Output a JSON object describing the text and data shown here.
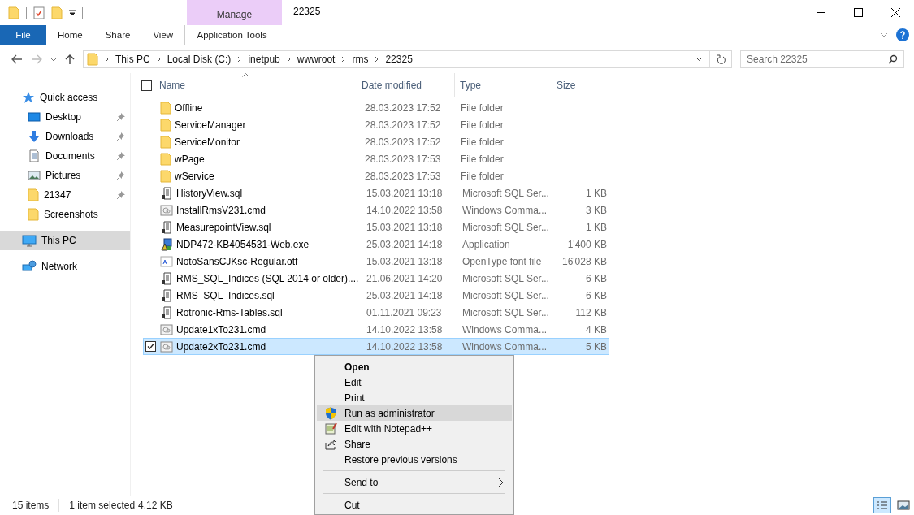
{
  "window": {
    "title": "22325",
    "context_tab": "Manage"
  },
  "ribbon_tabs": [
    {
      "label": "File",
      "kind": "file",
      "selected": false
    },
    {
      "label": "Home",
      "kind": "tab",
      "selected": false
    },
    {
      "label": "Share",
      "kind": "tab",
      "selected": false
    },
    {
      "label": "View",
      "kind": "tab",
      "selected": false
    },
    {
      "label": "Application Tools",
      "kind": "context",
      "selected": false
    }
  ],
  "address": {
    "path": [
      "This PC",
      "Local Disk (C:)",
      "inetpub",
      "wwwroot",
      "rms",
      "22325"
    ],
    "search_placeholder": "Search 22325"
  },
  "sidebar": {
    "items": [
      {
        "label": "Quick access",
        "kind": "star",
        "pinned": false,
        "selected": false,
        "group": true
      },
      {
        "label": "Desktop",
        "kind": "desktop",
        "pinned": true,
        "selected": false,
        "group": false
      },
      {
        "label": "Downloads",
        "kind": "downloads",
        "pinned": true,
        "selected": false,
        "group": false
      },
      {
        "label": "Documents",
        "kind": "documents",
        "pinned": true,
        "selected": false,
        "group": false
      },
      {
        "label": "Pictures",
        "kind": "pictures",
        "pinned": true,
        "selected": false,
        "group": false
      },
      {
        "label": "21347",
        "kind": "folder",
        "pinned": true,
        "selected": false,
        "group": false
      },
      {
        "label": "Screenshots",
        "kind": "folder",
        "pinned": false,
        "selected": false,
        "group": false
      },
      {
        "label": "This PC",
        "kind": "pc",
        "pinned": false,
        "selected": true,
        "group": true
      },
      {
        "label": "Network",
        "kind": "network",
        "pinned": false,
        "selected": false,
        "group": true
      }
    ]
  },
  "table": {
    "select_all_checked": false,
    "columns": [
      "Name",
      "Date modified",
      "Type",
      "Size"
    ],
    "rows": [
      {
        "name": "Offline",
        "date": "28.03.2023 17:52",
        "type": "File folder",
        "size": "",
        "kind": "folder",
        "selected": false
      },
      {
        "name": "ServiceManager",
        "date": "28.03.2023 17:52",
        "type": "File folder",
        "size": "",
        "kind": "folder",
        "selected": false
      },
      {
        "name": "ServiceMonitor",
        "date": "28.03.2023 17:52",
        "type": "File folder",
        "size": "",
        "kind": "folder",
        "selected": false
      },
      {
        "name": "wPage",
        "date": "28.03.2023 17:53",
        "type": "File folder",
        "size": "",
        "kind": "folder",
        "selected": false
      },
      {
        "name": "wService",
        "date": "28.03.2023 17:53",
        "type": "File folder",
        "size": "",
        "kind": "folder",
        "selected": false
      },
      {
        "name": "HistoryView.sql",
        "date": "15.03.2021 13:18",
        "type": "Microsoft SQL Ser...",
        "size": "1 KB",
        "kind": "sql",
        "selected": false
      },
      {
        "name": "InstallRmsV231.cmd",
        "date": "14.10.2022 13:58",
        "type": "Windows Comma...",
        "size": "3 KB",
        "kind": "cmd",
        "selected": false
      },
      {
        "name": "MeasurepointView.sql",
        "date": "15.03.2021 13:18",
        "type": "Microsoft SQL Ser...",
        "size": "1 KB",
        "kind": "sql",
        "selected": false
      },
      {
        "name": "NDP472-KB4054531-Web.exe",
        "date": "25.03.2021 14:18",
        "type": "Application",
        "size": "1'400 KB",
        "kind": "exe",
        "selected": false
      },
      {
        "name": "NotoSansCJKsc-Regular.otf",
        "date": "15.03.2021 13:18",
        "type": "OpenType font file",
        "size": "16'028 KB",
        "kind": "font",
        "selected": false
      },
      {
        "name": "RMS_SQL_Indices (SQL 2014 or older)....",
        "date": "21.06.2021 14:20",
        "type": "Microsoft SQL Ser...",
        "size": "6 KB",
        "kind": "sql",
        "selected": false
      },
      {
        "name": "RMS_SQL_Indices.sql",
        "date": "25.03.2021 14:18",
        "type": "Microsoft SQL Ser...",
        "size": "6 KB",
        "kind": "sql",
        "selected": false
      },
      {
        "name": "Rotronic-Rms-Tables.sql",
        "date": "01.11.2021 09:23",
        "type": "Microsoft SQL Ser...",
        "size": "112 KB",
        "kind": "sql",
        "selected": false
      },
      {
        "name": "Update1xTo231.cmd",
        "date": "14.10.2022 13:58",
        "type": "Windows Comma...",
        "size": "4 KB",
        "kind": "cmd",
        "selected": false
      },
      {
        "name": "Update2xTo231.cmd",
        "date": "14.10.2022 13:58",
        "type": "Windows Comma...",
        "size": "5 KB",
        "kind": "cmd",
        "selected": true
      }
    ]
  },
  "context_menu": [
    {
      "label": "Open",
      "kind": "plain",
      "bold": true,
      "selected": false,
      "submenu": false
    },
    {
      "label": "Edit",
      "kind": "plain",
      "bold": false,
      "selected": false,
      "submenu": false
    },
    {
      "label": "Print",
      "kind": "plain",
      "bold": false,
      "selected": false,
      "submenu": false
    },
    {
      "label": "Run as administrator",
      "kind": "shield",
      "bold": false,
      "selected": true,
      "submenu": false
    },
    {
      "label": "Edit with Notepad++",
      "kind": "notepad",
      "bold": false,
      "selected": false,
      "submenu": false
    },
    {
      "label": "Share",
      "kind": "share",
      "bold": false,
      "selected": false,
      "submenu": false
    },
    {
      "label": "Restore previous versions",
      "kind": "plain",
      "bold": false,
      "selected": false,
      "submenu": false
    },
    {
      "kind": "separator"
    },
    {
      "label": "Send to",
      "kind": "plain",
      "bold": false,
      "selected": false,
      "submenu": true
    },
    {
      "kind": "separator"
    },
    {
      "label": "Cut",
      "kind": "plain",
      "bold": false,
      "selected": false,
      "submenu": false
    }
  ],
  "status_bar": {
    "count": "15 items",
    "selection": "1 item selected",
    "size": "4.12 KB"
  }
}
